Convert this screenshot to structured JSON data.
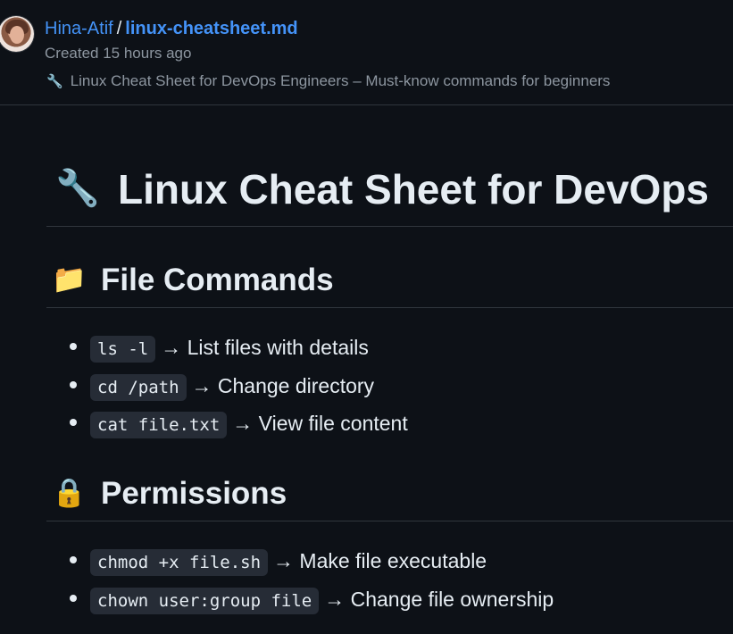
{
  "header": {
    "owner": "Hina-Atif",
    "separator": "/",
    "filename": "linux-cheatsheet.md",
    "created": "Created 15 hours ago",
    "description_icon": "wrench-emoji",
    "description": "Linux Cheat Sheet for DevOps Engineers – Must-know commands for beginners"
  },
  "document": {
    "title_emoji": "🔧",
    "title": "Linux Cheat Sheet for DevOps",
    "sections": [
      {
        "emoji": "📁",
        "heading": "File Commands",
        "items": [
          {
            "code": "ls -l",
            "text": "→ List files with details"
          },
          {
            "code": "cd /path",
            "text": "→ Change directory"
          },
          {
            "code": "cat file.txt",
            "text": "→ View file content"
          }
        ]
      },
      {
        "emoji": "🔒",
        "heading": "Permissions",
        "items": [
          {
            "code": "chmod +x file.sh",
            "text": "→ Make file executable"
          },
          {
            "code": "chown user:group file",
            "text": "→ Change file ownership"
          }
        ]
      }
    ]
  },
  "colors": {
    "background": "#0d1117",
    "link": "#4493f8",
    "muted": "#8d96a0",
    "code_bg": "#262c36",
    "border": "#30363d"
  }
}
